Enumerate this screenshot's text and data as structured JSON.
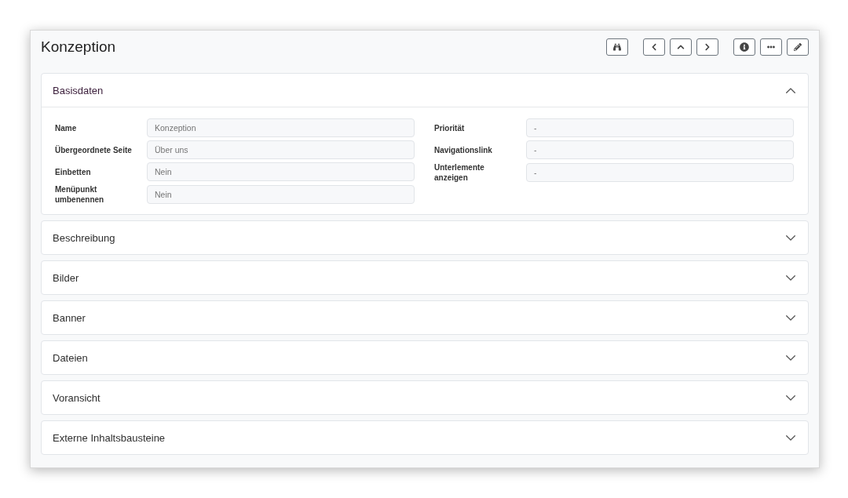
{
  "page": {
    "title": "Konzeption"
  },
  "toolbar": {
    "groups": [
      [
        {
          "kind": "search"
        }
      ],
      [
        {
          "kind": "previous"
        },
        {
          "kind": "up"
        },
        {
          "kind": "next"
        }
      ],
      [
        {
          "kind": "info"
        },
        {
          "kind": "more"
        },
        {
          "kind": "edit"
        }
      ]
    ]
  },
  "sections": [
    {
      "title": "Basisdaten",
      "expanded": true,
      "columns": [
        [
          {
            "label": "Name",
            "value": "Konzeption"
          },
          {
            "label": "Übergeordnete Seite",
            "value": "Über uns"
          },
          {
            "label": "Einbetten",
            "value": "Nein"
          },
          {
            "label": "Menüpunkt umbenennen",
            "value": "Nein"
          }
        ],
        [
          {
            "label": "Priorität",
            "value": "-"
          },
          {
            "label": "Navigationslink",
            "value": "-"
          },
          {
            "label": "Unterlemente anzeigen",
            "value": "-"
          }
        ]
      ]
    },
    {
      "title": "Beschreibung",
      "expanded": false
    },
    {
      "title": "Bilder",
      "expanded": false
    },
    {
      "title": "Banner",
      "expanded": false
    },
    {
      "title": "Dateien",
      "expanded": false
    },
    {
      "title": "Voransicht",
      "expanded": false
    },
    {
      "title": "Externe Inhaltsbausteine",
      "expanded": false
    }
  ]
}
